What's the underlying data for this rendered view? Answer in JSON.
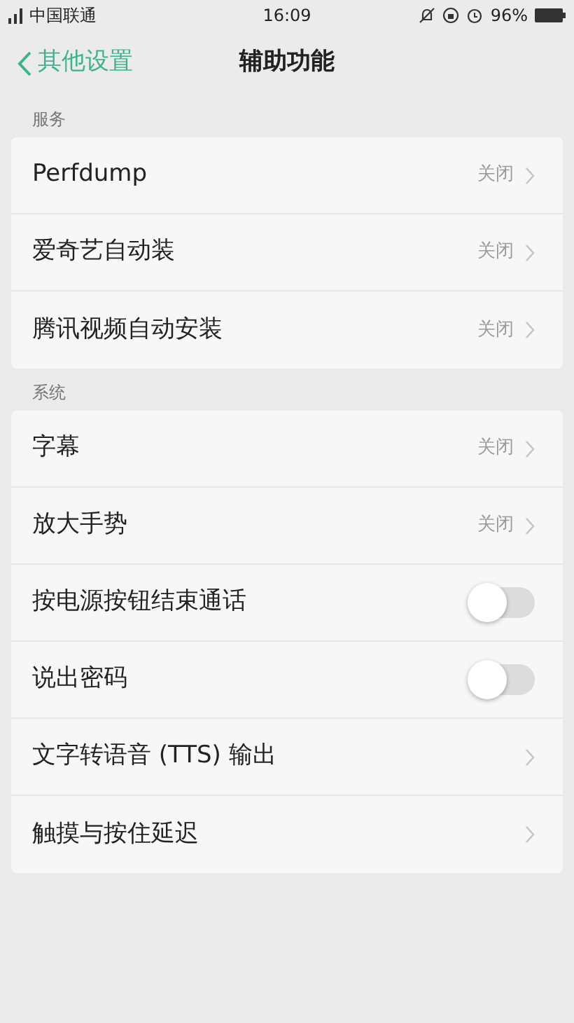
{
  "status_bar": {
    "carrier": "中国联通",
    "time": "16:09",
    "battery": "96%"
  },
  "header": {
    "back": "其他设置",
    "title": "辅助功能"
  },
  "sections": [
    {
      "title": "服务",
      "rows": [
        {
          "kind": "link",
          "label": "Perfdump",
          "value": "关闭"
        },
        {
          "kind": "link",
          "label": "爱奇艺自动装",
          "value": "关闭"
        },
        {
          "kind": "link",
          "label": "腾讯视频自动安装",
          "value": "关闭"
        }
      ]
    },
    {
      "title": "系统",
      "rows": [
        {
          "kind": "link",
          "label": "字幕",
          "value": "关闭"
        },
        {
          "kind": "link",
          "label": "放大手势",
          "value": "关闭"
        },
        {
          "kind": "toggle",
          "label": "按电源按钮结束通话",
          "on": false
        },
        {
          "kind": "toggle",
          "label": "说出密码",
          "on": false
        },
        {
          "kind": "link",
          "label": "文字转语音 (TTS) 输出"
        },
        {
          "kind": "link",
          "label": "触摸与按住延迟"
        }
      ]
    }
  ]
}
